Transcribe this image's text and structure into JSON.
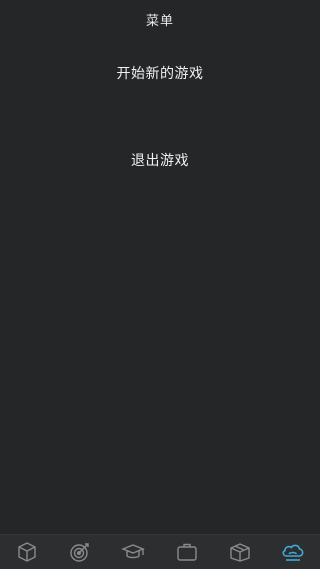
{
  "header": {
    "title": "菜单"
  },
  "menu": {
    "items": [
      {
        "label": "开始新的游戏"
      },
      {
        "label": "退出游戏"
      }
    ]
  },
  "tabbar": {
    "tabs": [
      {
        "icon": "cube-icon"
      },
      {
        "icon": "target-icon"
      },
      {
        "icon": "graduation-cap-icon"
      },
      {
        "icon": "briefcase-icon"
      },
      {
        "icon": "box-icon"
      },
      {
        "icon": "cloud-icon",
        "active": true
      }
    ],
    "colors": {
      "inactive": "#8a8b8c",
      "active": "#3fa9d8"
    }
  }
}
